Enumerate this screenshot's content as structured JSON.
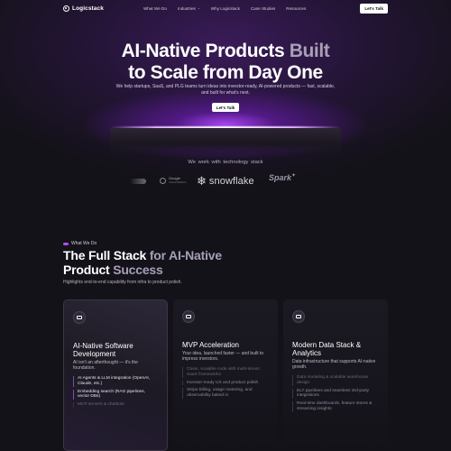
{
  "nav": {
    "logo": "Logicstack",
    "items": [
      {
        "label": "What We Do",
        "has_dropdown": false
      },
      {
        "label": "Industries",
        "has_dropdown": true
      },
      {
        "label": "Why Logicstack",
        "has_dropdown": false
      },
      {
        "label": "Case Studies",
        "has_dropdown": false
      },
      {
        "label": "Resources",
        "has_dropdown": false
      }
    ],
    "cta": "Let's Talk"
  },
  "hero": {
    "title_line1": "AI-Native Products ",
    "title_line1_muted": "Built",
    "title_line2": "to Scale from Day One",
    "subtitle": "We help startups, SaaS, and PLG teams turn ideas into investor-ready, AI-powered products — fast, scalable, and built for what's next.",
    "cta": "Let's Talk"
  },
  "stack": {
    "title_a": "We work with",
    "title_b": "technology stack",
    "logos": [
      {
        "name": "Google",
        "sub": "Cloud Platform"
      },
      {
        "name": "snowflake",
        "icon": "snowflake-icon"
      },
      {
        "name": "Spark",
        "icon": "spark-star-icon"
      }
    ]
  },
  "section": {
    "tag": "What We Do",
    "title_a": "The Full Stack ",
    "title_a_muted": "for AI-Native",
    "title_b": "Product ",
    "title_b_muted": "Success",
    "subtitle": "Highlights end-to-end capability from infra to product polish."
  },
  "cards": [
    {
      "title": "AI-Native Software Development",
      "desc": "AI isn't an afterthought — it's the foundation.",
      "items": [
        {
          "text": "AI Agents & LLM integration (OpenAI, Claude, etc.)",
          "dim": false
        },
        {
          "text": "Embedding search (RAG pipelines, vector DBs)",
          "dim": false
        },
        {
          "text": "MCP servers & chatbots",
          "dim": true
        }
      ]
    },
    {
      "title": "MVP Acceleration",
      "desc": "Your idea, launched faster — and built to impress investors.",
      "items": [
        {
          "text": "Clean, scalable code with multi-tenant SaaS frameworks",
          "lit": false
        },
        {
          "text": "Investor-ready UX and product polish",
          "lit": true
        },
        {
          "text": "Stripe billing, usage metering, and observability baked in",
          "lit": true
        }
      ]
    },
    {
      "title": "Modern Data Stack & Analytics",
      "desc": "Data infrastructure that supports AI-native growth.",
      "items": [
        {
          "text": "Data modeling & scalable warehouse design",
          "lit": false
        },
        {
          "text": "ELT pipelines and seamless 3rd-party integrations",
          "lit": true
        },
        {
          "text": "Real-time dashboards, feature stores & streaming insights",
          "lit": true
        }
      ]
    }
  ],
  "colors": {
    "background": "#141219",
    "accent": "#b34cf0",
    "muted_heading": "#a99fb8"
  }
}
